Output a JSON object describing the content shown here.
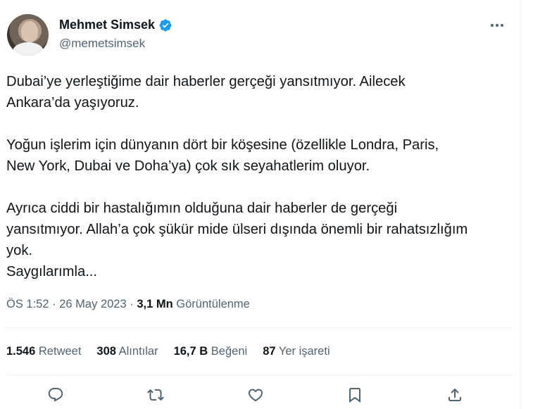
{
  "author": {
    "name": "Mehmet Simsek",
    "handle": "@memetsimsek",
    "verified_color": "#1d9bf0"
  },
  "tweet": {
    "paragraph1": "Dubai’ye yerleştiğime dair haberler gerçeği yansıtmıyor. Ailecek\nAnkara’da yaşıyoruz.",
    "paragraph2": "Yoğun işlerim için dünyanın dört bir köşesine (özellikle Londra, Paris,\nNew York, Dubai ve Doha’ya) çok sık seyahatlerim oluyor.",
    "paragraph3": "Ayrıca ciddi bir hastalığımın olduğuna dair haberler de gerçeği\nyansıtmıyor. Allah’a çok şükür mide ülseri dışında önemli bir rahatsızlığım\nyok.\nSaygılarımla..."
  },
  "meta": {
    "time": "ÖS 1:52",
    "sep": "·",
    "date": "26 May 2023",
    "views_count": "3,1 Mn",
    "views_label": "Görüntülenme"
  },
  "stats": {
    "retweets_count": "1.546",
    "retweets_label": "Retweet",
    "quotes_count": "308",
    "quotes_label": "Alıntılar",
    "likes_count": "16,7 B",
    "likes_label": "Beğeni",
    "bookmarks_count": "87",
    "bookmarks_label": "Yer işareti"
  },
  "icons": {
    "more": "more-horizontal-icon",
    "reply": "reply-icon",
    "retweet": "retweet-icon",
    "like": "like-icon",
    "bookmark": "bookmark-icon",
    "share": "share-icon",
    "icon_color": "#536471"
  }
}
